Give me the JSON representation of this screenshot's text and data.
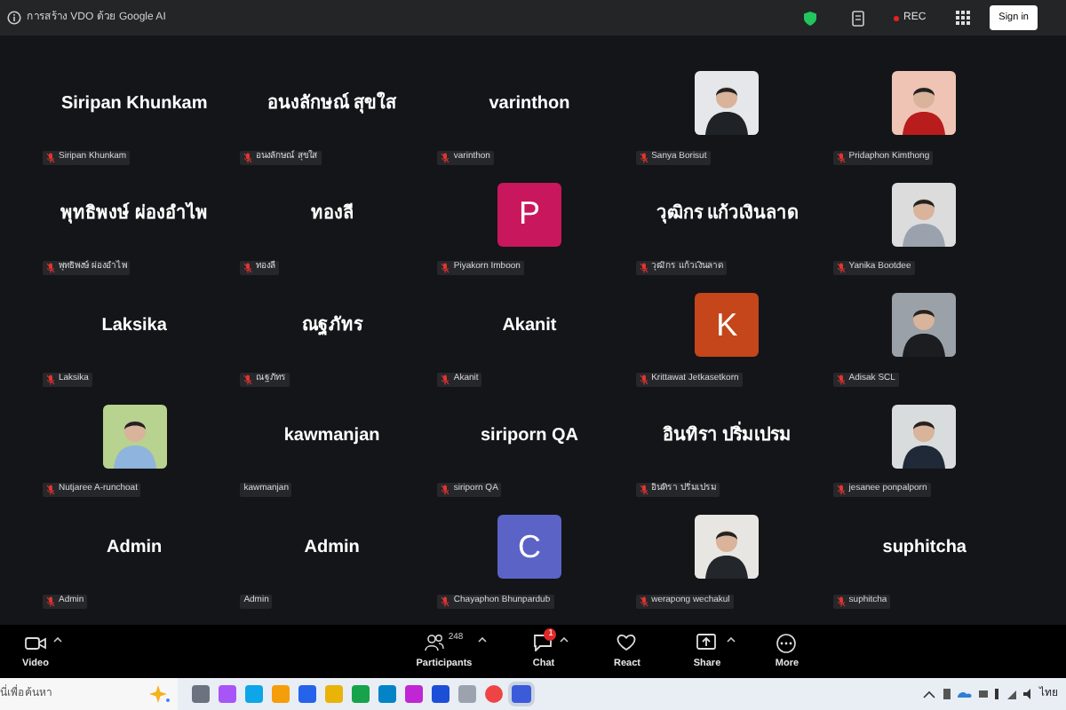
{
  "top_bar": {
    "title": "การสร้าง VDO ด้วย Google AI",
    "rec": "REC",
    "sign_in": "Sign in"
  },
  "tiles": [
    {
      "kind": "name",
      "display": "Siripan Khunkam",
      "label": "Siripan Khunkam",
      "muted": true
    },
    {
      "kind": "name",
      "display": "อนงลักษณ์  สุขใส",
      "label": "อนงลักษณ์  สุขใส",
      "muted": true
    },
    {
      "kind": "name",
      "display": "varinthon",
      "label": "varinthon",
      "muted": true
    },
    {
      "kind": "picture",
      "label": "Sanya Borisut",
      "muted": true
    },
    {
      "kind": "picture",
      "label": "Pridaphon Kimthong",
      "muted": true
    },
    {
      "kind": "name",
      "display": "พุทธิพงษ์ ผ่องอำไพ",
      "label": "พุทธิพงษ์ ผ่องอำไพ",
      "muted": true
    },
    {
      "kind": "name",
      "display": "ทองลี",
      "label": "ทองลี",
      "muted": true
    },
    {
      "kind": "avatar",
      "letter": "P",
      "color": "#c8175d",
      "label": "Piyakorn Imboon",
      "muted": true
    },
    {
      "kind": "name",
      "display": "วุฒิกร แก้วเงินลาด",
      "label": "วุฒิกร แก้วเงินลาด",
      "muted": true
    },
    {
      "kind": "picture",
      "label": "Yanika Bootdee",
      "muted": true
    },
    {
      "kind": "name",
      "display": "Laksika",
      "label": "Laksika",
      "muted": true
    },
    {
      "kind": "name",
      "display": "ณฐภัทร",
      "label": "ณฐภัทร",
      "muted": true
    },
    {
      "kind": "name",
      "display": "Akanit",
      "label": "Akanit",
      "muted": true
    },
    {
      "kind": "avatar",
      "letter": "K",
      "color": "#c4461a",
      "label": "Krittawat Jetkasetkorn",
      "muted": true
    },
    {
      "kind": "picture",
      "label": "Adisak SCL",
      "muted": true
    },
    {
      "kind": "picture",
      "label": "Nutjaree A-runchoat",
      "muted": true
    },
    {
      "kind": "name",
      "display": "kawmanjan",
      "label": "kawmanjan",
      "muted": false
    },
    {
      "kind": "name",
      "display": "siriporn QA",
      "label": "siriporn QA",
      "muted": true
    },
    {
      "kind": "name",
      "display": "อินทิรา ปริ่มเปรม",
      "label": "อินทิรา ปริ่มเปรม",
      "muted": true
    },
    {
      "kind": "picture",
      "label": "jesanee ponpalporn",
      "muted": true
    },
    {
      "kind": "name",
      "display": "Admin",
      "label": "Admin",
      "muted": true
    },
    {
      "kind": "name",
      "display": "Admin",
      "label": "Admin",
      "muted": false
    },
    {
      "kind": "avatar",
      "letter": "C",
      "color": "#5b63c7",
      "label": "Chayaphon Bhunpardub",
      "muted": true
    },
    {
      "kind": "picture",
      "label": "werapong wechakul",
      "muted": true
    },
    {
      "kind": "name",
      "display": "suphitcha",
      "label": "suphitcha",
      "muted": true
    }
  ],
  "toolbar": [
    {
      "kind": "video",
      "label": "Video",
      "caret": true
    },
    {
      "kind": "participants",
      "label": "Participants",
      "count": "248",
      "caret": true
    },
    {
      "kind": "chat",
      "label": "Chat",
      "badge": "1",
      "caret": true
    },
    {
      "kind": "react",
      "label": "React",
      "caret": false
    },
    {
      "kind": "share",
      "label": "Share",
      "caret": true
    },
    {
      "kind": "more",
      "label": "More",
      "caret": false
    }
  ],
  "taskbar": {
    "search_placeholder": "นี่เพื่อค้นหา",
    "language": "ไทย"
  }
}
